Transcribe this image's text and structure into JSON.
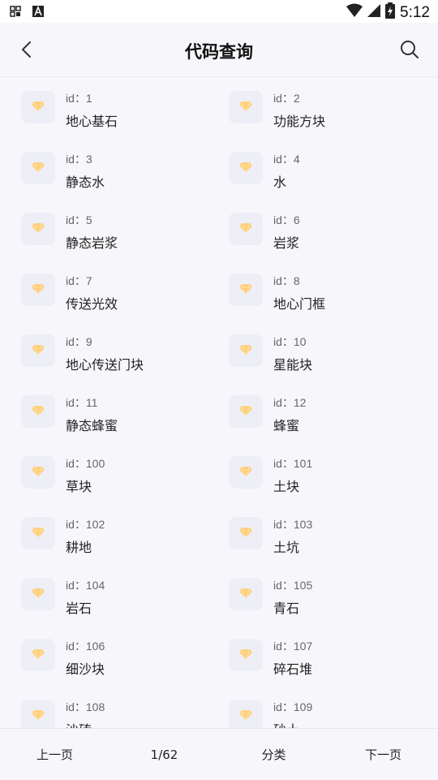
{
  "status_bar": {
    "time": "5:12",
    "left_icons": [
      "screenshot-icon",
      "a-box-icon"
    ],
    "right_icons": [
      "wifi-icon",
      "signal-icon",
      "battery-icon"
    ]
  },
  "header": {
    "title": "代码查询",
    "back_icon": "chevron-left-icon",
    "search_icon": "search-icon"
  },
  "items": [
    {
      "id_label": "id：1",
      "name": "地心基石"
    },
    {
      "id_label": "id：2",
      "name": "功能方块"
    },
    {
      "id_label": "id：3",
      "name": "静态水"
    },
    {
      "id_label": "id：4",
      "name": "水"
    },
    {
      "id_label": "id：5",
      "name": "静态岩浆"
    },
    {
      "id_label": "id：6",
      "name": "岩浆"
    },
    {
      "id_label": "id：7",
      "name": "传送光效"
    },
    {
      "id_label": "id：8",
      "name": "地心门框"
    },
    {
      "id_label": "id：9",
      "name": "地心传送门块"
    },
    {
      "id_label": "id：10",
      "name": "星能块"
    },
    {
      "id_label": "id：11",
      "name": "静态蜂蜜"
    },
    {
      "id_label": "id：12",
      "name": "蜂蜜"
    },
    {
      "id_label": "id：100",
      "name": "草块"
    },
    {
      "id_label": "id：101",
      "name": "土块"
    },
    {
      "id_label": "id：102",
      "name": "耕地"
    },
    {
      "id_label": "id：103",
      "name": "土坑"
    },
    {
      "id_label": "id：104",
      "name": "岩石"
    },
    {
      "id_label": "id：105",
      "name": "青石"
    },
    {
      "id_label": "id：106",
      "name": "细沙块"
    },
    {
      "id_label": "id：107",
      "name": "碎石堆"
    },
    {
      "id_label": "id：108",
      "name": "沙砖"
    },
    {
      "id_label": "id：109",
      "name": "砂土"
    }
  ],
  "item_icon": "diamond-icon",
  "colors": {
    "icon_tile": "#eeeef7",
    "diamond": "#ffcf7a",
    "background": "#f7f7fb"
  },
  "bottom_bar": {
    "prev_label": "上一页",
    "page_indicator": "1/62",
    "category_label": "分类",
    "next_label": "下一页"
  }
}
